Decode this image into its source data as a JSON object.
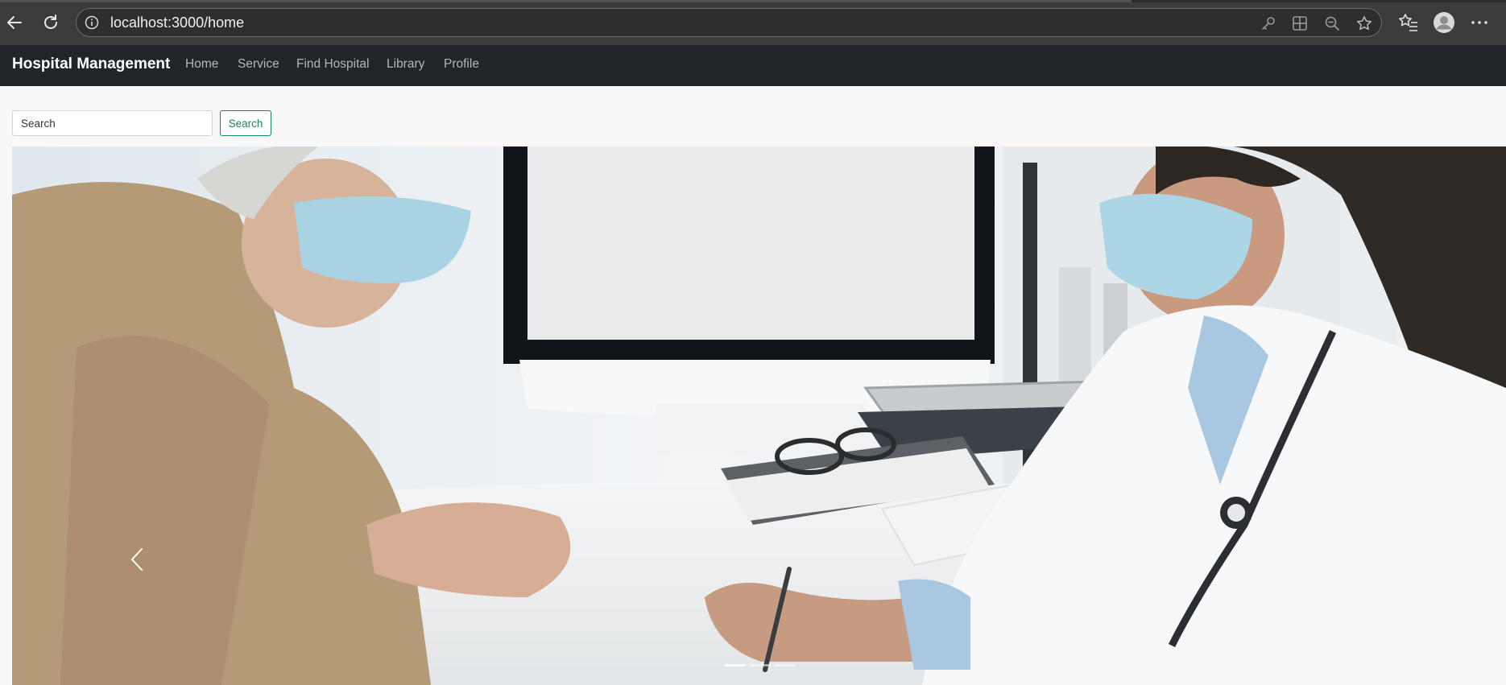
{
  "browser": {
    "url": "localhost:3000/home",
    "icons": [
      "back-icon",
      "refresh-icon",
      "info-icon",
      "key-icon",
      "apps-icon",
      "zoom-out-icon",
      "star-icon",
      "favorites-icon",
      "profile-icon",
      "more-icon"
    ]
  },
  "navbar": {
    "brand": "Hospital Management",
    "links": [
      "Home",
      "Service",
      "Find Hospital",
      "Library",
      "Profile"
    ]
  },
  "search": {
    "placeholder": "Search",
    "button_label": "Search"
  },
  "carousel": {
    "slide_count": 3,
    "active_index": 0,
    "image_subject": "masked patient and doctor at a desk"
  },
  "colors": {
    "navbar_bg": "#212529",
    "success": "#198754",
    "page_bg": "#f8f8f8",
    "browser_bg": "#3b3b3b"
  }
}
